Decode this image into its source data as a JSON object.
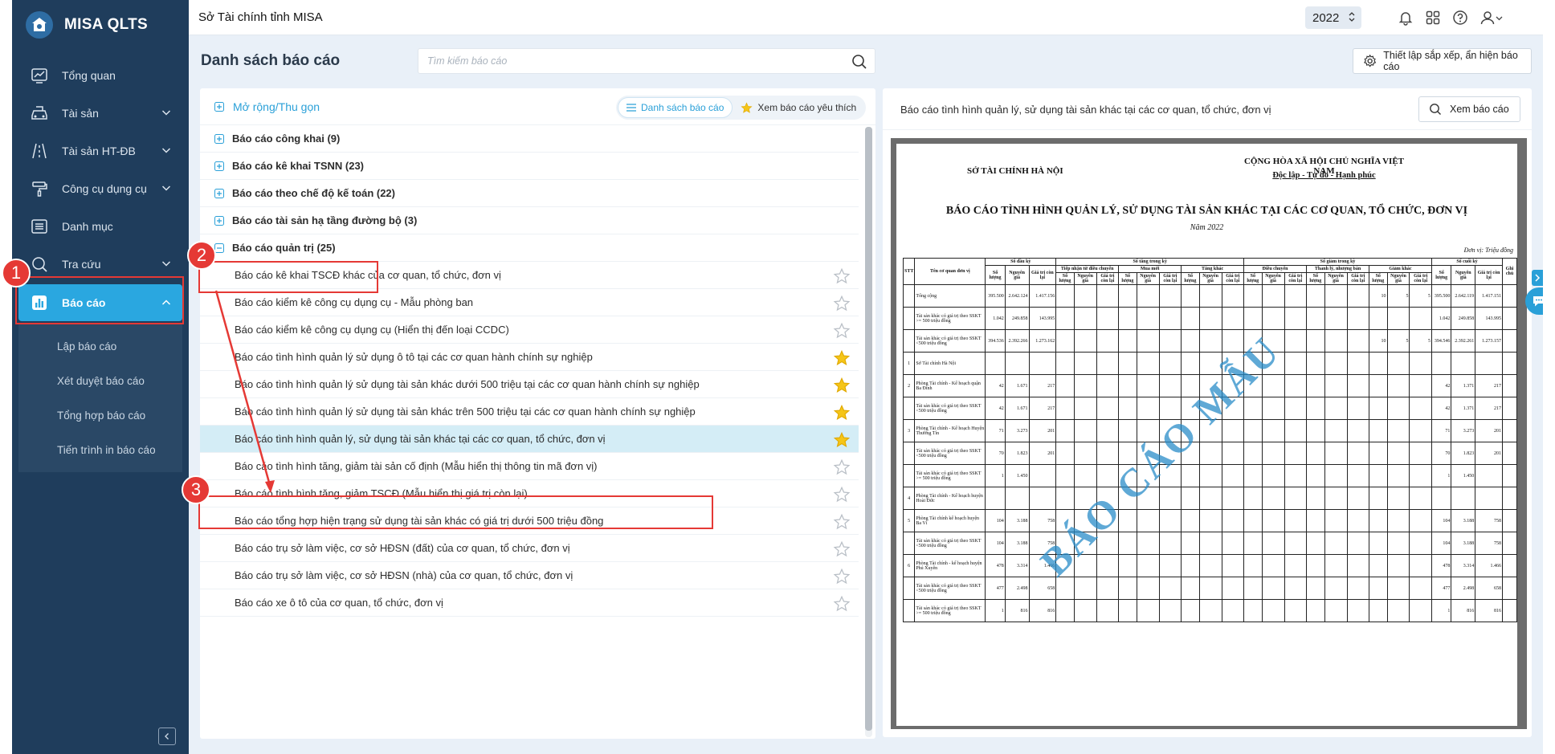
{
  "app": {
    "name": "MISA QLTS"
  },
  "sidebar": {
    "items": [
      {
        "label": "Tổng quan",
        "icon": "chart-line-icon",
        "expandable": false
      },
      {
        "label": "Tài sản",
        "icon": "car-icon",
        "expandable": true
      },
      {
        "label": "Tài sản HT-ĐB",
        "icon": "road-icon",
        "expandable": true
      },
      {
        "label": "Công cụ dụng cụ",
        "icon": "paint-roller-icon",
        "expandable": true
      },
      {
        "label": "Danh mục",
        "icon": "list-box-icon",
        "expandable": false
      },
      {
        "label": "Tra cứu",
        "icon": "search-doc-icon",
        "expandable": true
      },
      {
        "label": "Báo cáo",
        "icon": "bar-chart-icon",
        "expandable": true,
        "active": true
      }
    ],
    "subitems": [
      "Lập báo cáo",
      "Xét duyệt báo cáo",
      "Tổng hợp báo cáo",
      "Tiến trình in báo cáo"
    ]
  },
  "topbar": {
    "org": "Sở Tài chính tỉnh MISA",
    "year": "2022"
  },
  "header": {
    "title": "Danh sách báo cáo",
    "search_placeholder": "Tìm kiếm báo cáo",
    "settings_label": "Thiết lập sắp xếp, ẩn hiện báo cáo"
  },
  "list": {
    "expand_label": "Mở rộng/Thu gọn",
    "view_list_label": "Danh sách báo cáo",
    "view_fav_label": "Xem báo cáo yêu thích",
    "groups": [
      "Báo cáo công khai (9)",
      "Báo cáo kê khai TSNN (23)",
      "Báo cáo theo chế độ kế toán (22)",
      "Báo cáo tài sản hạ tầng đường bộ (3)",
      "Báo cáo quản trị (25)"
    ],
    "reports": [
      {
        "label": "Báo cáo kê khai TSCĐ khác của cơ quan, tổ chức, đơn vị",
        "fav": false
      },
      {
        "label": "Báo cáo kiểm kê công cụ dụng cụ - Mẫu phòng ban",
        "fav": false
      },
      {
        "label": "Báo cáo kiểm kê công cụ dụng cụ (Hiển thị đến loại CCDC)",
        "fav": false
      },
      {
        "label": "Báo cáo tình hình quản lý sử dụng ô tô tại các cơ quan hành chính sự nghiệp",
        "fav": true
      },
      {
        "label": "Báo cáo tình hình quản lý sử dụng tài sản khác dưới 500 triệu tại các cơ quan hành chính sự nghiệp",
        "fav": true
      },
      {
        "label": "Báo cáo tình hình quản lý sử dụng tài sản khác trên 500 triệu tại các cơ quan hành chính sự nghiệp",
        "fav": true
      },
      {
        "label": "Báo cáo tình hình quản lý, sử dụng tài sản khác tại các cơ quan, tổ chức, đơn vị",
        "fav": true,
        "selected": true
      },
      {
        "label": "Báo cáo tình hình tăng, giảm tài sản cố định (Mẫu hiển thị thông tin mã đơn vị)",
        "fav": false
      },
      {
        "label": "Báo cáo tình hình tăng, giảm TSCĐ (Mẫu hiển thị giá trị còn lại)",
        "fav": false
      },
      {
        "label": "Báo cáo tổng hợp hiện trạng sử dụng tài sản khác có giá trị dưới 500 triệu đồng",
        "fav": false
      },
      {
        "label": "Báo cáo trụ sở làm việc, cơ sở HĐSN (đất) của cơ quan, tổ chức, đơn vị",
        "fav": false
      },
      {
        "label": "Báo cáo trụ sở làm việc, cơ sở HĐSN (nhà) của cơ quan, tổ chức, đơn vị",
        "fav": false
      },
      {
        "label": "Báo cáo xe ô tô của cơ quan, tổ chức, đơn vị",
        "fav": false
      }
    ]
  },
  "preview": {
    "title": "Báo cáo tình hình quản lý, sử dụng tài sản khác tại các cơ quan, tổ chức, đơn vị",
    "view_label": "Xem báo cáo",
    "doc": {
      "org": "SỞ TÀI CHÍNH HÀ NỘI",
      "nation": "CỘNG HÒA XÃ HỘI CHỦ NGHĨA VIỆT NAM",
      "motto": "Độc lập - Tự do - Hạnh phúc",
      "title": "BÁO CÁO TÌNH HÌNH QUẢN LÝ, SỬ DỤNG TÀI SẢN KHÁC TẠI CÁC CƠ QUAN, TỔ CHỨC, ĐƠN VỊ",
      "year": "Năm 2022",
      "unit": "Đơn vị: Triệu đồng",
      "watermark": "BÁO CÁO MẪU",
      "h_stt": "STT",
      "h_name": "Tên cơ quan đơn vị",
      "h_open": "Số đầu kỳ",
      "h_inc": "Số tăng trong kỳ",
      "h_dec": "Số giảm trong kỳ",
      "h_close": "Số cuối kỳ",
      "h_note": "Ghi chú",
      "h_inc_sub": [
        "Tiếp nhận từ điều chuyển",
        "Mua mới",
        "Tăng khác"
      ],
      "h_dec_sub": [
        "Điều chuyển",
        "Thanh lý, nhượng bán",
        "Giảm khác"
      ],
      "h_qty": "Số lượng",
      "h_orig": "Nguyên giá",
      "h_rem": "Giá trị còn lại",
      "rows": [
        {
          "stt": "",
          "name": "Tổng cộng",
          "open": [
            "395.500",
            "2.642.124",
            "1.417.156"
          ],
          "decq": "10",
          "deco": "5",
          "decr": "5",
          "close": [
            "395.500",
            "2.642.119",
            "1.417.151"
          ]
        },
        {
          "stt": "",
          "name": "Tài sản khác có giá trị theo SSKT >= 500 triệu đồng",
          "open": [
            "1.042",
            "249.858",
            "143.995"
          ],
          "decq": "",
          "deco": "",
          "decr": "",
          "close": [
            "1.042",
            "249.858",
            "143.995"
          ]
        },
        {
          "stt": "",
          "name": "Tài sản khác có giá trị theo SSKT <500 triệu đồng",
          "open": [
            "394.536",
            "2.392.266",
            "1.273.162"
          ],
          "decq": "10",
          "deco": "5",
          "decr": "5",
          "close": [
            "394.546",
            "2.392.261",
            "1.273.157"
          ]
        },
        {
          "stt": "1",
          "name": "Sở Tài chính Hà Nội",
          "open": [
            "",
            "",
            ""
          ],
          "decq": "",
          "deco": "",
          "decr": "",
          "close": [
            "",
            "",
            ""
          ]
        },
        {
          "stt": "2",
          "name": "Phòng Tài chính - Kế hoạch quận Ba Đình",
          "open": [
            "42",
            "1.671",
            "217"
          ],
          "decq": "",
          "deco": "",
          "decr": "",
          "close": [
            "42",
            "1.371",
            "217"
          ]
        },
        {
          "stt": "",
          "name": "Tài sản khác có giá trị theo SSKT <500 triệu đồng",
          "open": [
            "42",
            "1.671",
            "217"
          ],
          "decq": "",
          "deco": "",
          "decr": "",
          "close": [
            "42",
            "1.371",
            "217"
          ]
        },
        {
          "stt": "3",
          "name": "Phòng Tài chính - Kế hoạch Huyện Thường Tín",
          "open": [
            "71",
            "3.273",
            "201"
          ],
          "decq": "",
          "deco": "",
          "decr": "",
          "close": [
            "71",
            "3.273",
            "201"
          ]
        },
        {
          "stt": "",
          "name": "Tài sản khác có giá trị theo SSKT <500 triệu đồng",
          "open": [
            "70",
            "1.823",
            "201"
          ],
          "decq": "",
          "deco": "",
          "decr": "",
          "close": [
            "70",
            "1.823",
            "201"
          ]
        },
        {
          "stt": "",
          "name": "Tài sản khác có giá trị theo SSKT >= 500 triệu đồng",
          "open": [
            "1",
            "1.450",
            ""
          ],
          "decq": "",
          "deco": "",
          "decr": "",
          "close": [
            "1",
            "1.450",
            ""
          ]
        },
        {
          "stt": "4",
          "name": "Phòng Tài chính - Kế hoạch huyện Hoài Đức",
          "open": [
            "",
            "",
            ""
          ],
          "decq": "",
          "deco": "",
          "decr": "",
          "close": [
            "",
            "",
            ""
          ]
        },
        {
          "stt": "5",
          "name": "Phòng Tài chính kế hoạch huyện Ba Vì",
          "open": [
            "104",
            "3.188",
            "758"
          ],
          "decq": "",
          "deco": "",
          "decr": "",
          "close": [
            "104",
            "3.188",
            "758"
          ]
        },
        {
          "stt": "",
          "name": "Tài sản khác có giá trị theo SSKT <500 triệu đồng",
          "open": [
            "104",
            "3.188",
            "758"
          ],
          "decq": "",
          "deco": "",
          "decr": "",
          "close": [
            "104",
            "3.188",
            "758"
          ]
        },
        {
          "stt": "6",
          "name": "Phòng Tài chính - kế hoạch huyện Phú Xuyên",
          "open": [
            "478",
            "3.314",
            "1.466"
          ],
          "decq": "",
          "deco": "",
          "decr": "",
          "close": [
            "478",
            "3.314",
            "1.466"
          ]
        },
        {
          "stt": "",
          "name": "Tài sản khác có giá trị theo SSKT <500 triệu đồng",
          "open": [
            "477",
            "2.498",
            "658"
          ],
          "decq": "",
          "deco": "",
          "decr": "",
          "close": [
            "477",
            "2.498",
            "658"
          ]
        },
        {
          "stt": "",
          "name": "Tài sản khác có giá trị theo SSKT >= 500 triệu đồng",
          "open": [
            "1",
            "816",
            "816"
          ],
          "decq": "",
          "deco": "",
          "decr": "",
          "close": [
            "1",
            "816",
            "816"
          ]
        }
      ]
    }
  },
  "annotations": [
    "1",
    "2",
    "3"
  ],
  "colors": {
    "sidebar": "#1f3d5c",
    "accent": "#2aa7e0",
    "annotation": "#e53935",
    "star": "#f5c518"
  }
}
